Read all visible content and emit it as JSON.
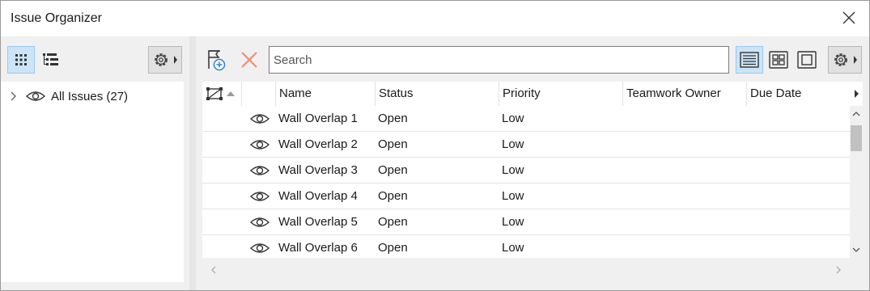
{
  "window": {
    "title": "Issue Organizer",
    "icons": {
      "close": "close-icon"
    }
  },
  "left_panel": {
    "toolbar": {
      "icons": [
        "grid-view-icon",
        "tree-view-icon",
        "gear-menu-icon"
      ]
    },
    "tree": {
      "items": [
        {
          "label": "All Issues (27)",
          "icon": "eye-icon",
          "expander": "chevron-right-icon"
        }
      ]
    }
  },
  "right_panel": {
    "toolbar": {
      "icons": [
        "new-issue-icon",
        "delete-icon",
        "details-view-icon",
        "thumbnail-view-icon",
        "single-view-icon",
        "gear-menu-icon"
      ],
      "search": {
        "placeholder": "Search",
        "value": ""
      }
    },
    "table": {
      "columns": [
        "",
        "",
        "Name",
        "Status",
        "Priority",
        "Teamwork Owner",
        "Due Date"
      ],
      "rows": [
        {
          "name": "Wall Overlap 1",
          "status": "Open",
          "priority": "Low",
          "owner": "",
          "due": ""
        },
        {
          "name": "Wall Overlap 2",
          "status": "Open",
          "priority": "Low",
          "owner": "",
          "due": ""
        },
        {
          "name": "Wall Overlap 3",
          "status": "Open",
          "priority": "Low",
          "owner": "",
          "due": ""
        },
        {
          "name": "Wall Overlap 4",
          "status": "Open",
          "priority": "Low",
          "owner": "",
          "due": ""
        },
        {
          "name": "Wall Overlap 5",
          "status": "Open",
          "priority": "Low",
          "owner": "",
          "due": ""
        },
        {
          "name": "Wall Overlap 6",
          "status": "Open",
          "priority": "Low",
          "owner": "",
          "due": ""
        }
      ]
    }
  },
  "colors": {
    "accent_bg": "#cce4f7",
    "accent_border": "#99c9ef",
    "delete": "#f08c73",
    "icon": "#333333"
  }
}
